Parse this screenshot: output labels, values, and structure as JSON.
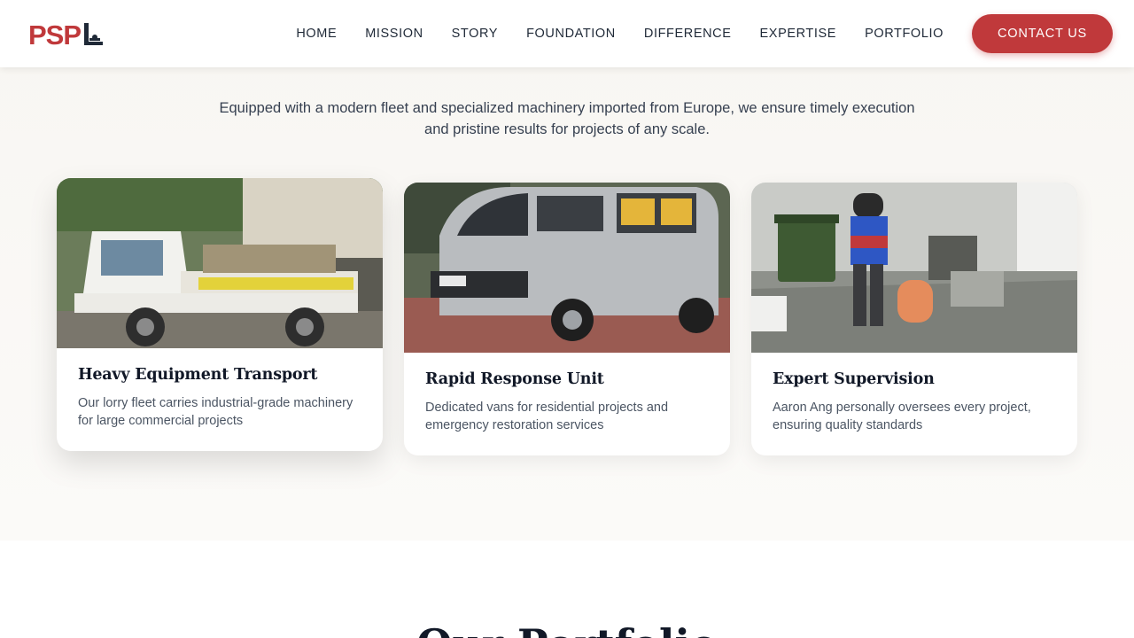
{
  "header": {
    "logo_text": "PSPL",
    "nav": [
      "HOME",
      "MISSION",
      "STORY",
      "FOUNDATION",
      "DIFFERENCE",
      "EXPERTISE",
      "PORTFOLIO"
    ],
    "cta_label": "CONTACT US"
  },
  "fleet": {
    "intro": "Equipped with a modern fleet and specialized machinery imported from Europe, we ensure timely execution and pristine results for projects of any scale.",
    "cards": [
      {
        "title": "Heavy Equipment Transport",
        "description": "Our lorry fleet carries industrial-grade machinery for large commercial projects",
        "image": "lorry-photo"
      },
      {
        "title": "Rapid Response Unit",
        "description": "Dedicated vans for residential projects and emergency restoration services",
        "image": "van-photo"
      },
      {
        "title": "Expert Supervision",
        "description": "Aaron Ang personally oversees every project, ensuring quality standards",
        "image": "supervision-photo"
      }
    ]
  },
  "portfolio": {
    "title": "Our Portfolio"
  },
  "colors": {
    "accent": "#c0393b",
    "section_bg": "#f8f6f2",
    "text_dark": "#111827"
  }
}
